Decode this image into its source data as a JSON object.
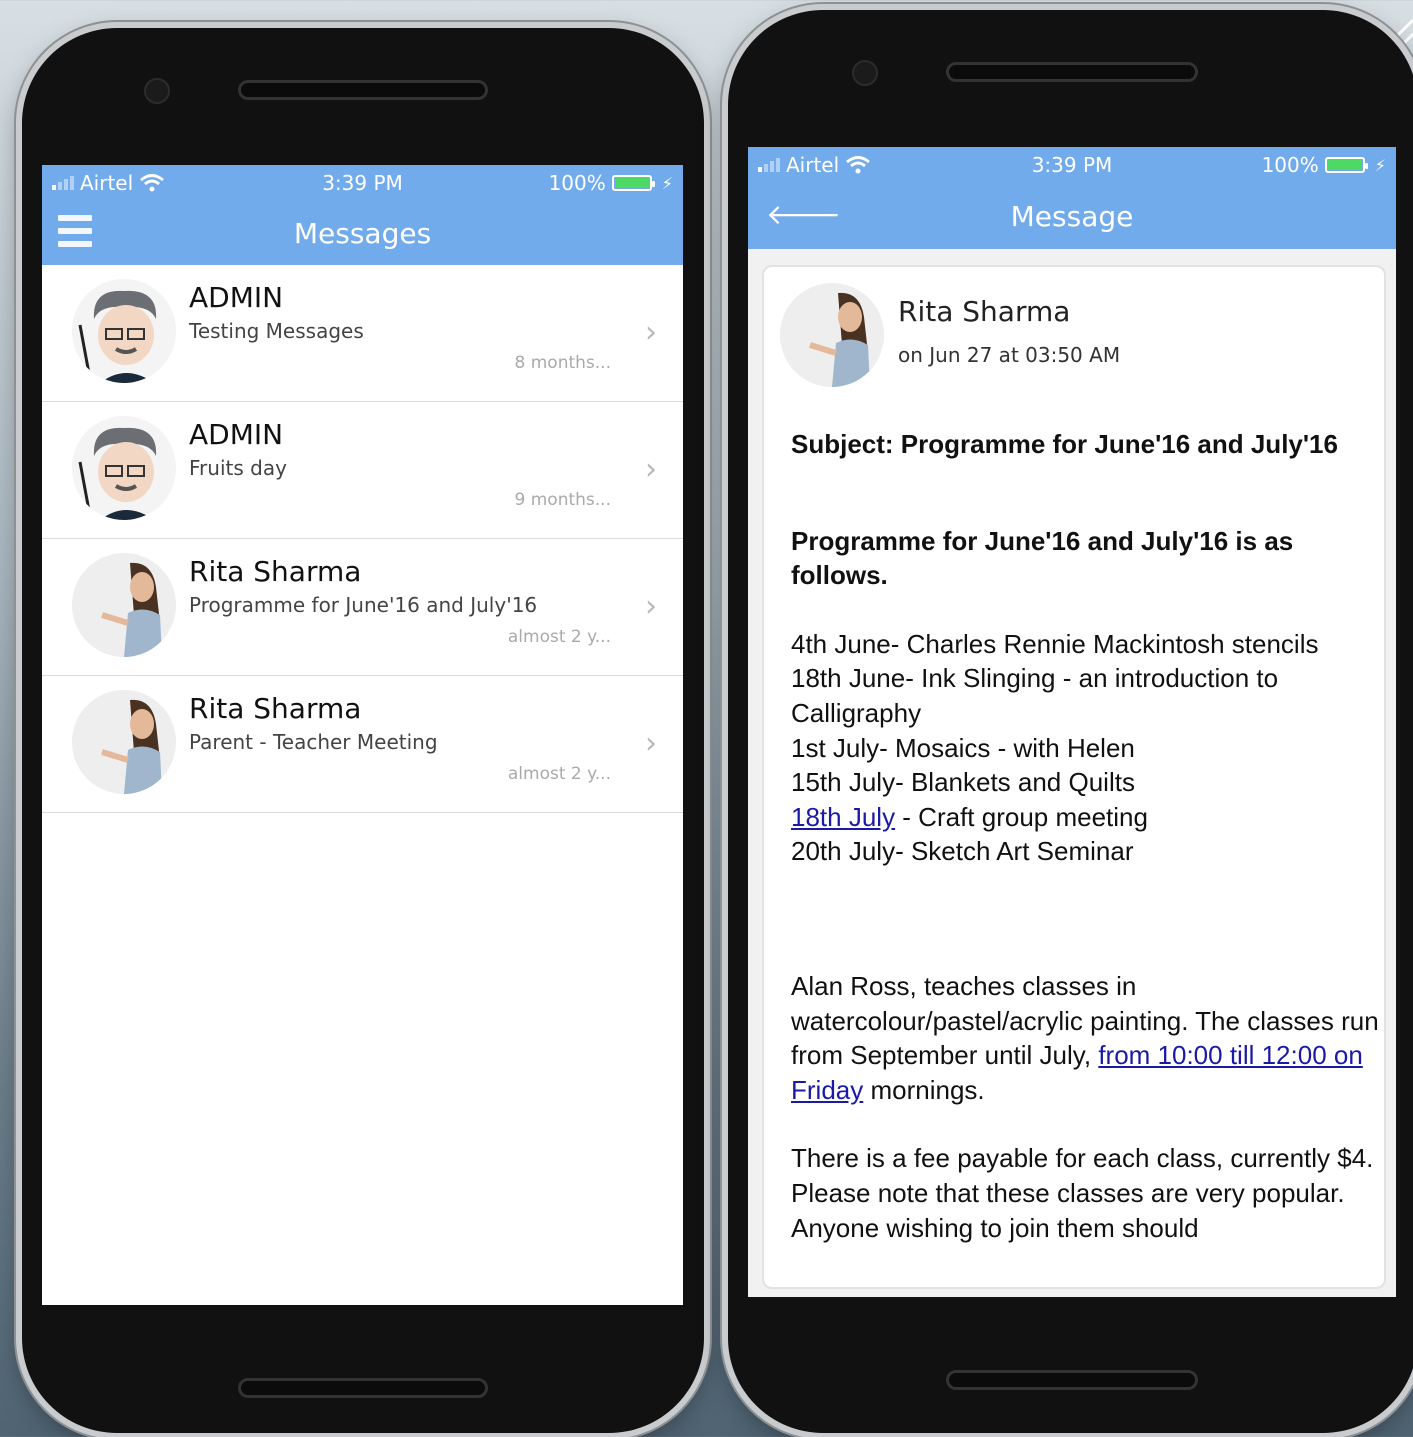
{
  "colors": {
    "accent": "#72abec",
    "battery": "#4cd964"
  },
  "status_bar": {
    "carrier": "Airtel",
    "time": "3:39 PM",
    "battery": "100%"
  },
  "left_screen": {
    "title": "Messages",
    "menu_icon": "hamburger-menu-icon",
    "messages": [
      {
        "sender": "ADMIN",
        "snippet": "Testing Messages",
        "time": "8 months...",
        "avatar": "admin-cartoon-avatar"
      },
      {
        "sender": "ADMIN",
        "snippet": "Fruits day",
        "time": "9 months...",
        "avatar": "admin-cartoon-avatar"
      },
      {
        "sender": "Rita Sharma",
        "snippet": "Programme for June'16 and July'16",
        "time": "almost 2 y...",
        "avatar": "teacher-photo-avatar"
      },
      {
        "sender": "Rita Sharma",
        "snippet": "Parent - Teacher Meeting",
        "time": "almost 2 y...",
        "avatar": "teacher-photo-avatar"
      }
    ]
  },
  "right_screen": {
    "title": "Message",
    "back_icon": "back-arrow-icon",
    "sender": "Rita Sharma",
    "date": "on Jun 27 at 03:50 AM",
    "subject": "Subject: Programme for June'16 and July'16",
    "heading": "Programme for June'16 and July'16 is as follows.",
    "schedule": {
      "line1": "4th June- Charles Rennie Mackintosh stencils",
      "line2": "18th June- Ink Slinging - an introduction to Calligraphy",
      "line3": "1st July- Mosaics - with Helen",
      "line4": "15th July- Blankets and Quilts",
      "line5_link": "18th July",
      "line5_rest": " - Craft group meeting",
      "line6": "20th July- Sketch Art Seminar"
    },
    "para1_start": "Alan Ross, teaches classes in watercolour/pastel/acrylic painting. The classes run from September until July, ",
    "para1_link": "from 10:00 till 12:00 on Friday",
    "para1_end": " mornings.",
    "para2": "There is a fee payable for each class, currently $4. Please note that these classes are very popular. Anyone wishing to join them should"
  }
}
